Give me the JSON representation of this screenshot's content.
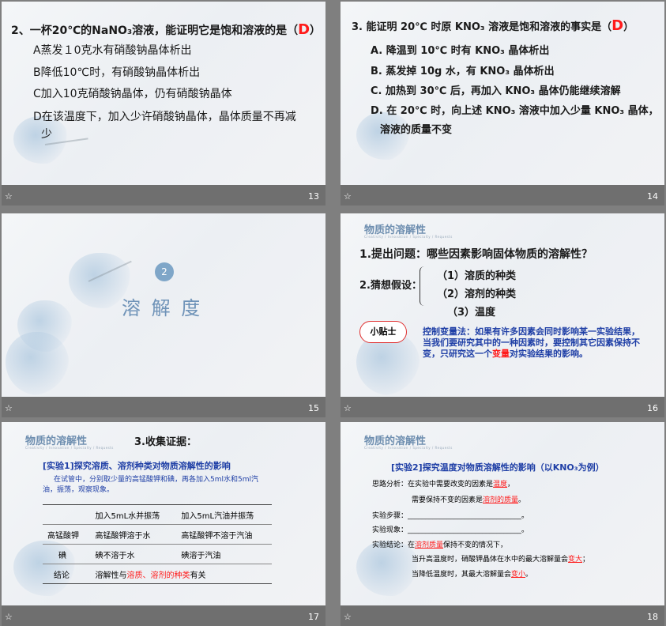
{
  "slides": {
    "s13": {
      "number": "13",
      "question": "2、一杯20℃的NaNO₃溶液，能证明它是饱和溶液的是（",
      "answer": "D",
      "close": "）",
      "options": [
        "A蒸发１0克水有硝酸钠晶体析出",
        "B降低10℃时，有硝酸钠晶体析出",
        "C加入10克硝酸钠晶体，仍有硝酸钠晶体",
        "D在该温度下，加入少许硝酸钠晶体，晶体质量不再减",
        "少"
      ]
    },
    "s14": {
      "number": "14",
      "question": "3. 能证明 20℃ 时原 KNO₃ 溶液是饱和溶液的事实是（",
      "answer": "D",
      "close": "）",
      "options": [
        "A. 降温到 10℃ 时有 KNO₃ 晶体析出",
        "B. 蒸发掉 10g 水，有 KNO₃ 晶体析出",
        "C. 加热到 30℃ 后，再加入 KNO₃ 晶体仍能继续溶解",
        "D. 在 20℃ 时，向上述 KNO₃ 溶液中加入少量 KNO₃ 晶体，",
        "溶液的质量不变"
      ]
    },
    "s15": {
      "number": "15",
      "badge": "2",
      "title": "溶 解 度"
    },
    "s16": {
      "number": "16",
      "section": "物质的溶解性",
      "section_sub": "Creativity / Innovation / Specialty / Requests",
      "q1": "1.提出问题：哪些因素影响固体物质的溶解性？",
      "q2": "2.猜想假设：",
      "hypotheses": [
        "（1）溶质的种类",
        "（2）溶剂的种类",
        "（3）温度"
      ],
      "tip_label": "小贴士",
      "tip_text_a": "控制变量法：如果有许多因素会同时影响某一实验结果，当我们要研究其中的一种因素时，要控制其它因素保持不变，只研究这一个",
      "tip_text_red": "变量",
      "tip_text_b": "对实验结果的影响。"
    },
    "s17": {
      "number": "17",
      "section": "物质的溶解性",
      "section_sub": "Creativity / Innovation / Specialty / Requests",
      "heading": "3.收集证据：",
      "exp_title": "[实验1]探究溶质、溶剂种类对物质溶解性的影响",
      "exp_desc": "在试管中，分别取少量的高锰酸钾和碘，再各加入5ml水和5ml汽油，振荡，观察现象。",
      "table": {
        "headers": [
          "",
          "加入5mL水并振荡",
          "加入5mL汽油并振荡"
        ],
        "rows": [
          [
            "高锰酸钾",
            "高锰酸钾溶于水",
            "高锰酸钾不溶于汽油"
          ],
          [
            "碘",
            "碘不溶于水",
            "碘溶于汽油"
          ]
        ],
        "conclusion_label": "结论",
        "conclusion_a": "溶解性与",
        "conclusion_red": "溶质、溶剂的种类",
        "conclusion_b": "有关"
      }
    },
    "s18": {
      "number": "18",
      "section": "物质的溶解性",
      "section_sub": "Creativity / Innovation / Specialty / Requests",
      "exp_title": "[实验2]探究温度对物质溶解性的影响（以KNO₃为例）",
      "l1a": "思路分析：在实验中需要改变的因素是",
      "l1red": "温度",
      "l1b": "，",
      "l2a": "需要保持不变的因素是",
      "l2red": "溶剂的质量",
      "l2b": "。",
      "l3": "实验步骤：________________________________。",
      "l4": "实验现象：________________________________。",
      "l5a": "实验结论：在",
      "l5red": "溶剂质量",
      "l5b": "保持不变的情况下，",
      "l6a": "当升高温度时，硝酸钾晶体在水中的最大溶解量会",
      "l6red": "变大",
      "l6b": "；",
      "l7a": "当降低温度时，其最大溶解量会",
      "l7red": "变小",
      "l7b": "。"
    }
  },
  "colors": {
    "bg": "#7f7f7f",
    "red": "#ff1a1a",
    "blue": "#1f3fa6",
    "section": "#6f8fb0"
  },
  "icons": {
    "slide_star": "star-icon"
  }
}
